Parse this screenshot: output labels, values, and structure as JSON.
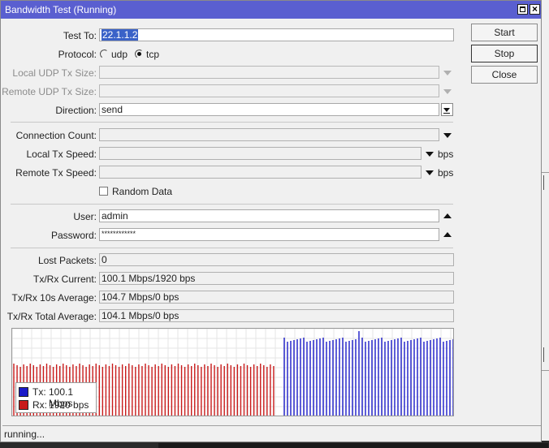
{
  "window": {
    "title": "Bandwidth Test (Running)"
  },
  "form": {
    "test_to_label": "Test To:",
    "test_to_value": "22.1.1.2",
    "protocol_label": "Protocol:",
    "protocol_udp": "udp",
    "protocol_tcp": "tcp",
    "protocol_selected": "tcp",
    "local_udp_label": "Local UDP Tx Size:",
    "remote_udp_label": "Remote UDP Tx Size:",
    "direction_label": "Direction:",
    "direction_value": "send",
    "connection_count_label": "Connection Count:",
    "local_tx_label": "Local Tx Speed:",
    "remote_tx_label": "Remote Tx Speed:",
    "speed_unit": "bps",
    "random_data_label": "Random Data",
    "random_data_checked": false,
    "user_label": "User:",
    "user_value": "admin",
    "password_label": "Password:",
    "password_value": "************"
  },
  "stats": {
    "lost_packets_label": "Lost Packets:",
    "lost_packets_value": "0",
    "current_label": "Tx/Rx Current:",
    "current_value": "100.1 Mbps/1920 bps",
    "avg10_label": "Tx/Rx 10s Average:",
    "avg10_value": "104.7 Mbps/0 bps",
    "total_label": "Tx/Rx Total Average:",
    "total_value": "104.1 Mbps/0 bps"
  },
  "buttons": {
    "start": "Start",
    "stop": "Stop",
    "close": "Close"
  },
  "graph": {
    "tx_color": "#1a1ac8",
    "rx_color": "#c81a1a",
    "legend_tx_label": "Tx:",
    "legend_tx_value": "100.1 Mbps",
    "legend_rx_label": "Rx:",
    "legend_rx_value": "1920 bps",
    "rx_bars": 80,
    "tx_bars": 53
  },
  "status": {
    "text": "running..."
  }
}
